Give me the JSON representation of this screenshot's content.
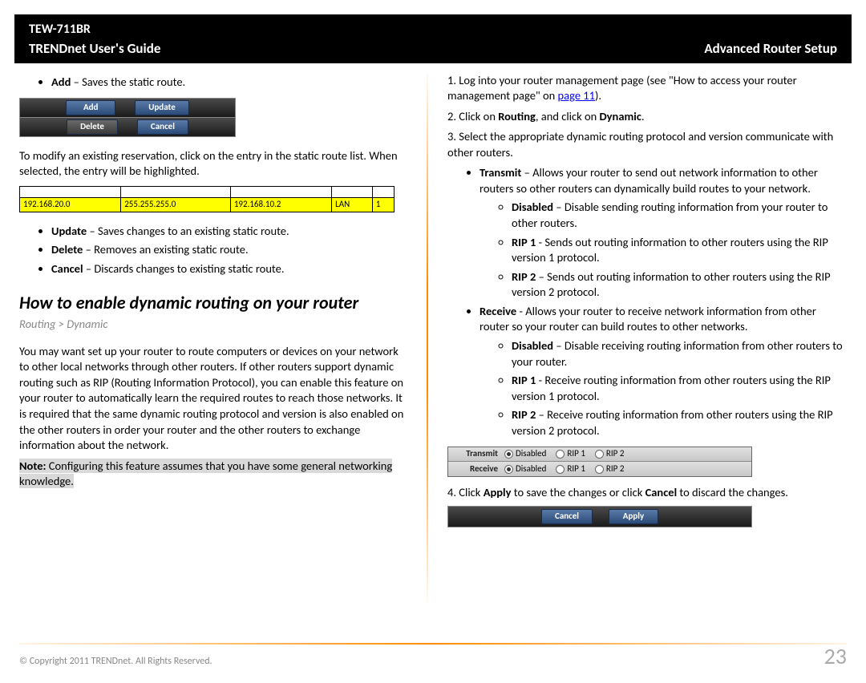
{
  "header": {
    "model": "TEW-711BR",
    "guide": "TRENDnet User's Guide",
    "section": "Advanced Router Setup"
  },
  "left": {
    "add_bullet_b": "Add",
    "add_bullet": " – Saves the static route.",
    "btn_add": "Add",
    "btn_update": "Update",
    "btn_delete": "Delete",
    "btn_cancel": "Cancel",
    "modify_para": "To modify an existing reservation, click on the entry in the static route list. When selected, the entry will be highlighted.",
    "route": {
      "c1": "192.168.20.0",
      "c2": "255.255.255.0",
      "c3": "192.168.10.2",
      "c4": "LAN",
      "c5": "1"
    },
    "update_b": "Update",
    "update_t": " – Saves changes to an existing static route.",
    "delete_b": "Delete",
    "delete_t": " – Removes an existing static route.",
    "cancel_b": "Cancel",
    "cancel_t": " – Discards changes to existing static route.",
    "h2": "How to enable dynamic routing on your router",
    "crumb": "Routing > Dynamic",
    "para2": "You may want set up your router to route computers or devices on your network to other local networks through other routers. If other routers support dynamic routing such as RIP (Routing Information Protocol), you can enable this feature on your router to automatically learn the required routes to reach those networks. It is required that the same dynamic routing protocol and version is also enabled on the other routers in order your router and the other routers to exchange information about the network.",
    "note_b": "Note:",
    "note_t": " Configuring this feature assumes that you have some general networking knowledge."
  },
  "right": {
    "step1a": "1. Log into your router management page (see \"How to access your router management page\" on ",
    "step1link": "page 11",
    "step1b": ").",
    "step2a": "2. Click on ",
    "step2b1": "Routing",
    "step2mid": ", and click on ",
    "step2b2": "Dynamic",
    "step2end": ".",
    "step3": "3. Select the appropriate dynamic routing protocol and version communicate with other routers.",
    "transmit_b": "Transmit",
    "transmit_t": " – Allows your router to send out network information to other routers so other routers can dynamically build routes to your network.",
    "t_dis_b": "Disabled",
    "t_dis_t": " – Disable sending routing information from your router to other routers.",
    "t_r1_b": "RIP 1",
    "t_r1_t": "  - Sends out routing information to other routers using the RIP version 1 protocol.",
    "t_r2_b": "RIP 2",
    "t_r2_t": " – Sends out routing information to other routers using the RIP version 2 protocol.",
    "receive_b": "Receive",
    "receive_t": "  - Allows your router to receive network information from other router so your router can build routes to other networks.",
    "r_dis_b": "Disabled",
    "r_dis_t": " – Disable receiving routing information from other routers to your router.",
    "r_r1_b": "RIP 1",
    "r_r1_t": "  - Receive routing information from other routers using the RIP version 1 protocol.",
    "r_r2_b": "RIP 2",
    "r_r2_t": " – Receive routing information from other routers using the RIP version 2 protocol.",
    "radio": {
      "transmit_label": "Transmit",
      "receive_label": "Receive",
      "opt_disabled": "Disabled",
      "opt_rip1": "RIP 1",
      "opt_rip2": "RIP 2"
    },
    "step4a": "4. Click ",
    "step4b1": "Apply",
    "step4mid": " to save the changes or click ",
    "step4b2": "Cancel",
    "step4end": " to discard the changes.",
    "btn_cancel": "Cancel",
    "btn_apply": "Apply"
  },
  "footer": {
    "copyright": "© Copyright 2011 TRENDnet. All Rights Reserved.",
    "page": "23"
  }
}
